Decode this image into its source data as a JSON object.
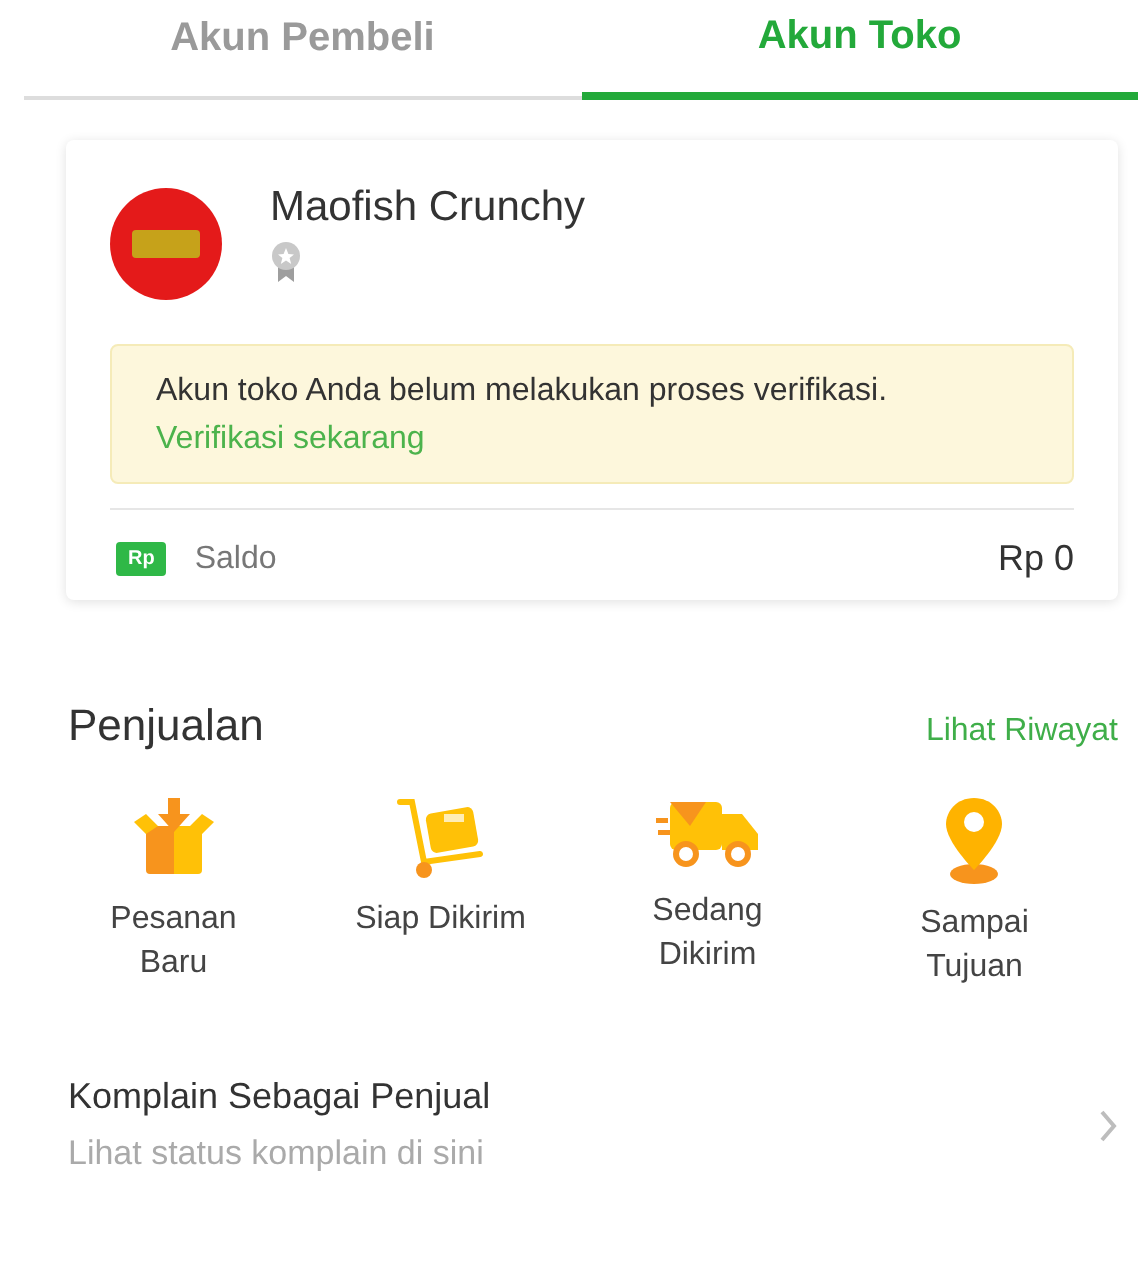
{
  "tabs": [
    {
      "label": "Akun Pembeli",
      "selected": false
    },
    {
      "label": "Akun Toko",
      "selected": true
    }
  ],
  "shop": {
    "name": "Maofish Crunchy",
    "notice": {
      "text": "Akun toko Anda belum melakukan proses verifikasi.",
      "link": "Verifikasi sekarang"
    },
    "balance": {
      "icon_text": "Rp",
      "label": "Saldo",
      "amount": "Rp 0"
    }
  },
  "sales": {
    "title": "Penjualan",
    "link": "Lihat Riwayat",
    "items": [
      {
        "kind": "box",
        "label": "Pesanan Baru"
      },
      {
        "kind": "trolley",
        "label": "Siap Dikirim"
      },
      {
        "kind": "truck",
        "label": "Sedang Dikirim"
      },
      {
        "kind": "pin",
        "label": "Sampai Tujuan"
      }
    ]
  },
  "complaint": {
    "title": "Komplain Sebagai Penjual",
    "subtitle": "Lihat status komplain di sini"
  }
}
